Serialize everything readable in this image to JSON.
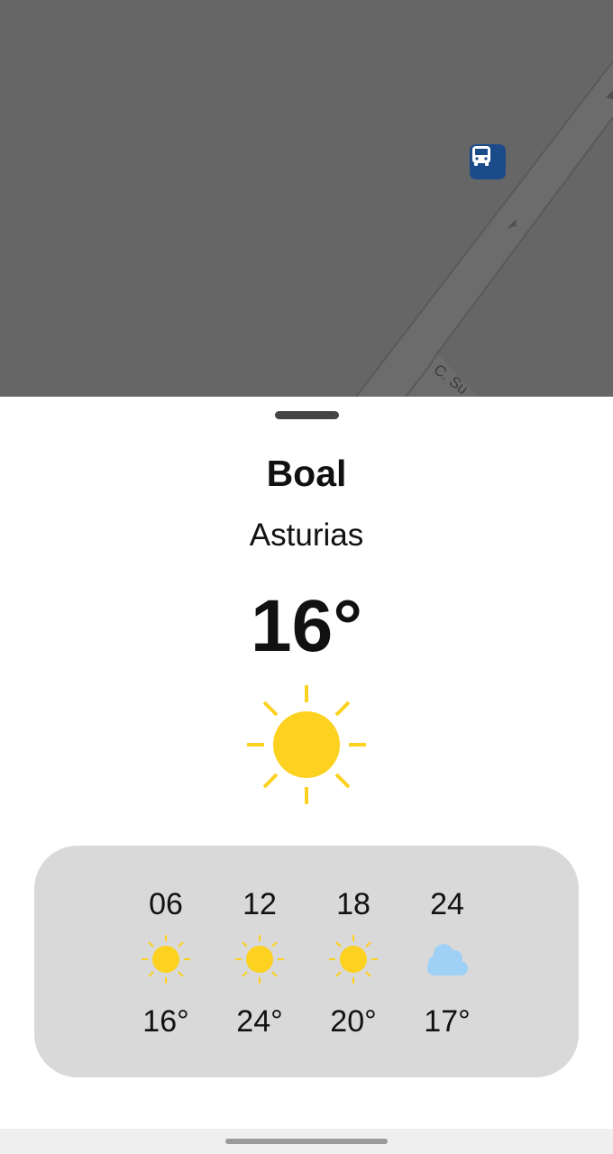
{
  "map": {
    "street_label": "C. Su",
    "bus_stop_icon": "bus-icon"
  },
  "weather": {
    "city": "Boal",
    "region": "Asturias",
    "current_temp": "16°",
    "current_icon": "sun-icon",
    "forecast": [
      {
        "hour": "06",
        "temp": "16°",
        "icon": "sun-icon"
      },
      {
        "hour": "12",
        "temp": "24°",
        "icon": "sun-icon"
      },
      {
        "hour": "18",
        "temp": "20°",
        "icon": "sun-icon"
      },
      {
        "hour": "24",
        "temp": "17°",
        "icon": "cloud-icon"
      }
    ]
  },
  "colors": {
    "sun": "#fcd11f",
    "cloud": "#9fd0f5",
    "forecast_panel": "#d9d9d9",
    "bus_stop": "#1c4b8a",
    "map_overlay": "#656665"
  }
}
